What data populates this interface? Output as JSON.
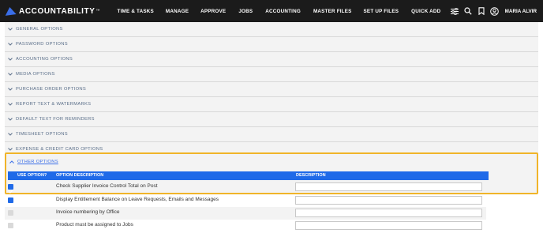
{
  "brand": {
    "name": "ACCOUNTABILITY",
    "tm": "™"
  },
  "nav": [
    {
      "label": "TIME & TASKS"
    },
    {
      "label": "MANAGE"
    },
    {
      "label": "APPROVE"
    },
    {
      "label": "JOBS"
    },
    {
      "label": "ACCOUNTING"
    },
    {
      "label": "MASTER FILES"
    },
    {
      "label": "SET UP FILES"
    },
    {
      "label": "QUICK ADD"
    }
  ],
  "user": {
    "name": "MARIA ALVIR"
  },
  "icons": {
    "filters": "sliders-icon",
    "search": "search-icon",
    "bookmark": "bookmark-icon",
    "account": "user-circle-icon"
  },
  "sections": [
    {
      "label": "GENERAL OPTIONS"
    },
    {
      "label": "PASSWORD OPTIONS"
    },
    {
      "label": "ACCOUNTING OPTIONS"
    },
    {
      "label": "MEDIA OPTIONS"
    },
    {
      "label": "PURCHASE ORDER OPTIONS"
    },
    {
      "label": "REPORT TEXT & WATERMARKS"
    },
    {
      "label": "DEFAULT TEXT FOR REMINDERS"
    },
    {
      "label": "TIMESHEET OPTIONS"
    },
    {
      "label": "EXPENSE & CREDIT CARD OPTIONS"
    }
  ],
  "other_options": {
    "label": "OTHER OPTIONS",
    "columns": {
      "use": "USE OPTION?",
      "option": "OPTION DESCRIPTION",
      "description": "DESCRIPTION"
    },
    "rows": [
      {
        "checked": true,
        "text": "Check Supplier Invoice Control Total on Post",
        "description": ""
      },
      {
        "checked": true,
        "text": "Display Entitlement Balance on Leave Requests, Emails and Messages",
        "description": ""
      },
      {
        "checked": false,
        "text": "Invoice numbering by Office",
        "description": ""
      },
      {
        "checked": false,
        "text": "Product must be assigned to Jobs",
        "description": ""
      }
    ]
  },
  "colors": {
    "accent": "#1f6ae8",
    "highlight_border": "#f0b429",
    "topbar": "#1b1b1b",
    "section_text": "#5b6f8a"
  }
}
